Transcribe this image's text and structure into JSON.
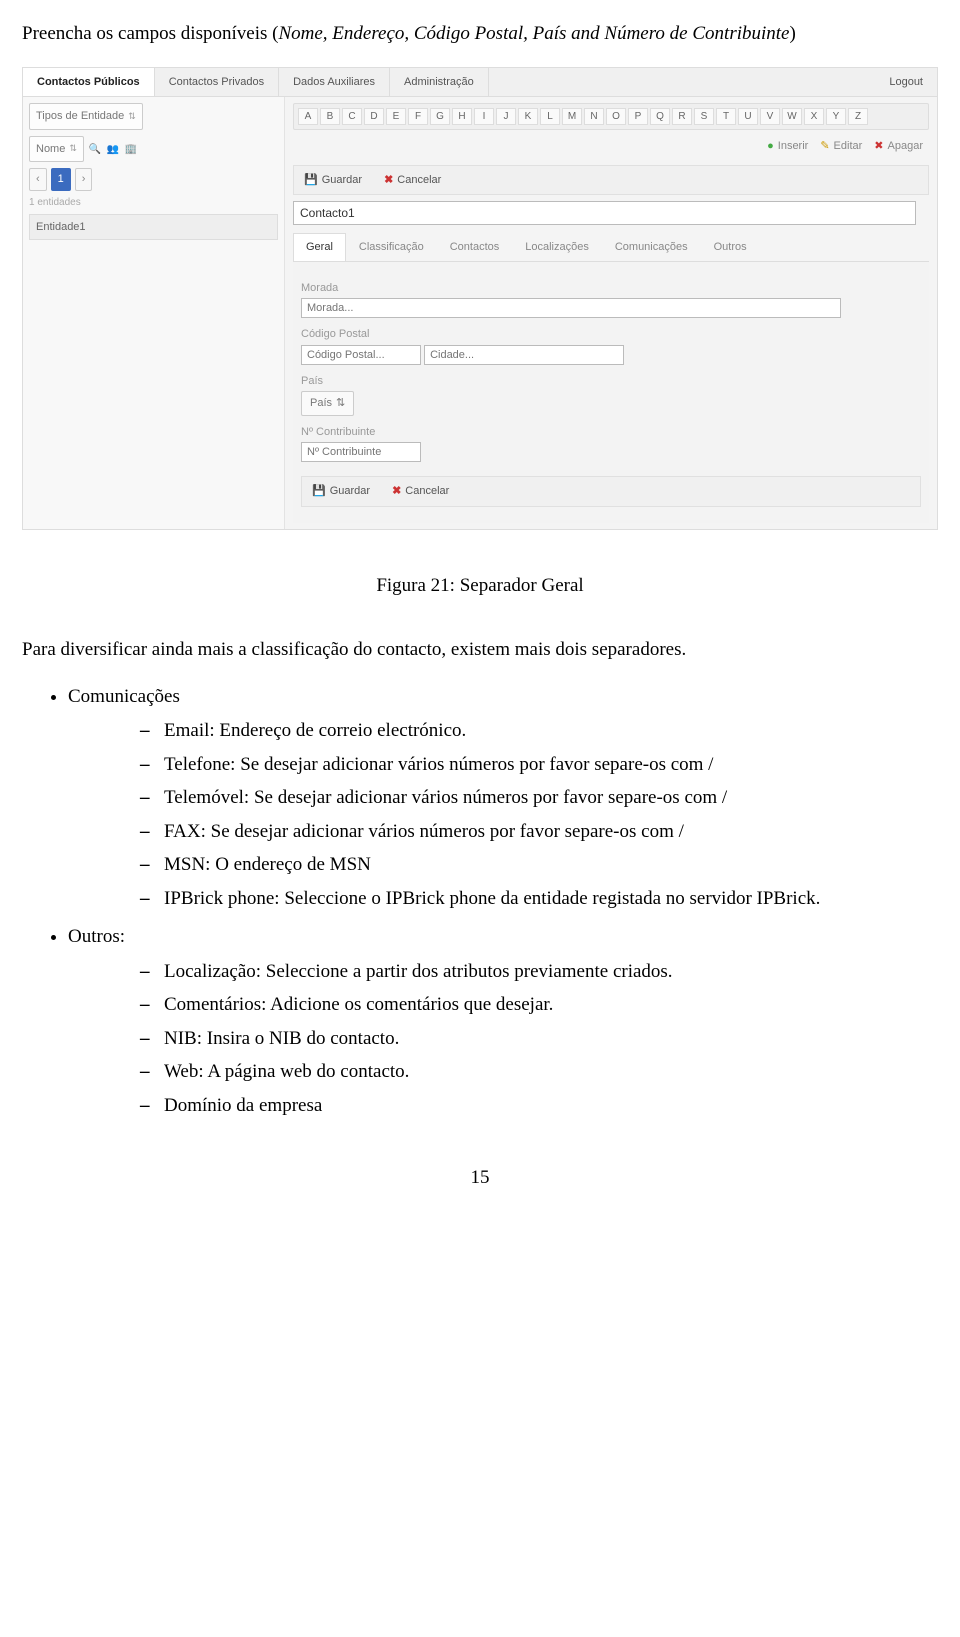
{
  "intro": {
    "lead_pre": "Preencha os campos disponíveis (",
    "italic": "Nome, Endereço, Código Postal, País and Número de Contribuinte",
    "lead_post": ")"
  },
  "app": {
    "top_tabs": [
      "Contactos Públicos",
      "Contactos Privados",
      "Dados Auxiliares",
      "Administração"
    ],
    "logout": "Logout",
    "left": {
      "tipos": "Tipos de Entidade",
      "nome": "Nome",
      "page_current": "1",
      "entidades_count": "1 entidades",
      "entidade": "Entidade1"
    },
    "letters": [
      "A",
      "B",
      "C",
      "D",
      "E",
      "F",
      "G",
      "H",
      "I",
      "J",
      "K",
      "L",
      "M",
      "N",
      "O",
      "P",
      "Q",
      "R",
      "S",
      "T",
      "U",
      "V",
      "W",
      "X",
      "Y",
      "Z"
    ],
    "actions": {
      "inserir": "Inserir",
      "editar": "Editar",
      "apagar": "Apagar"
    },
    "save_cancel": {
      "guardar": "Guardar",
      "cancelar": "Cancelar"
    },
    "name_value": "Contacto1",
    "subtabs": [
      "Geral",
      "Classificação",
      "Contactos",
      "Localizações",
      "Comunicações",
      "Outros"
    ],
    "form": {
      "morada_label": "Morada",
      "morada_placeholder": "Morada...",
      "cp_label": "Código Postal",
      "cp_placeholder": "Código Postal...",
      "cidade_placeholder": "Cidade...",
      "pais_label": "País",
      "pais_select": "País",
      "nc_label": "Nº Contribuinte",
      "nc_placeholder": "Nº Contribuinte"
    }
  },
  "caption": "Figura 21: Separador Geral",
  "para_after": "Para diversificar ainda mais a classificação do contacto, existem mais dois separadores.",
  "sections": {
    "comunicacoes": {
      "title": "Comunicações",
      "items": [
        "Email: Endereço de correio electrónico.",
        "Telefone: Se desejar adicionar vários números por favor separe-os com /",
        "Telemóvel: Se desejar adicionar vários números por favor separe-os com /",
        "FAX: Se desejar adicionar vários números por favor separe-os com /",
        "MSN: O endereço de MSN",
        "IPBrick phone: Seleccione o IPBrick phone da entidade registada no servidor IPBrick."
      ]
    },
    "outros": {
      "title": "Outros:",
      "items": [
        "Localização: Seleccione a partir dos atributos previamente criados.",
        "Comentários: Adicione os comentários que desejar.",
        "NIB: Insira o NIB do contacto.",
        "Web: A página web do contacto.",
        "Domínio da empresa"
      ]
    }
  },
  "page_number": "15"
}
